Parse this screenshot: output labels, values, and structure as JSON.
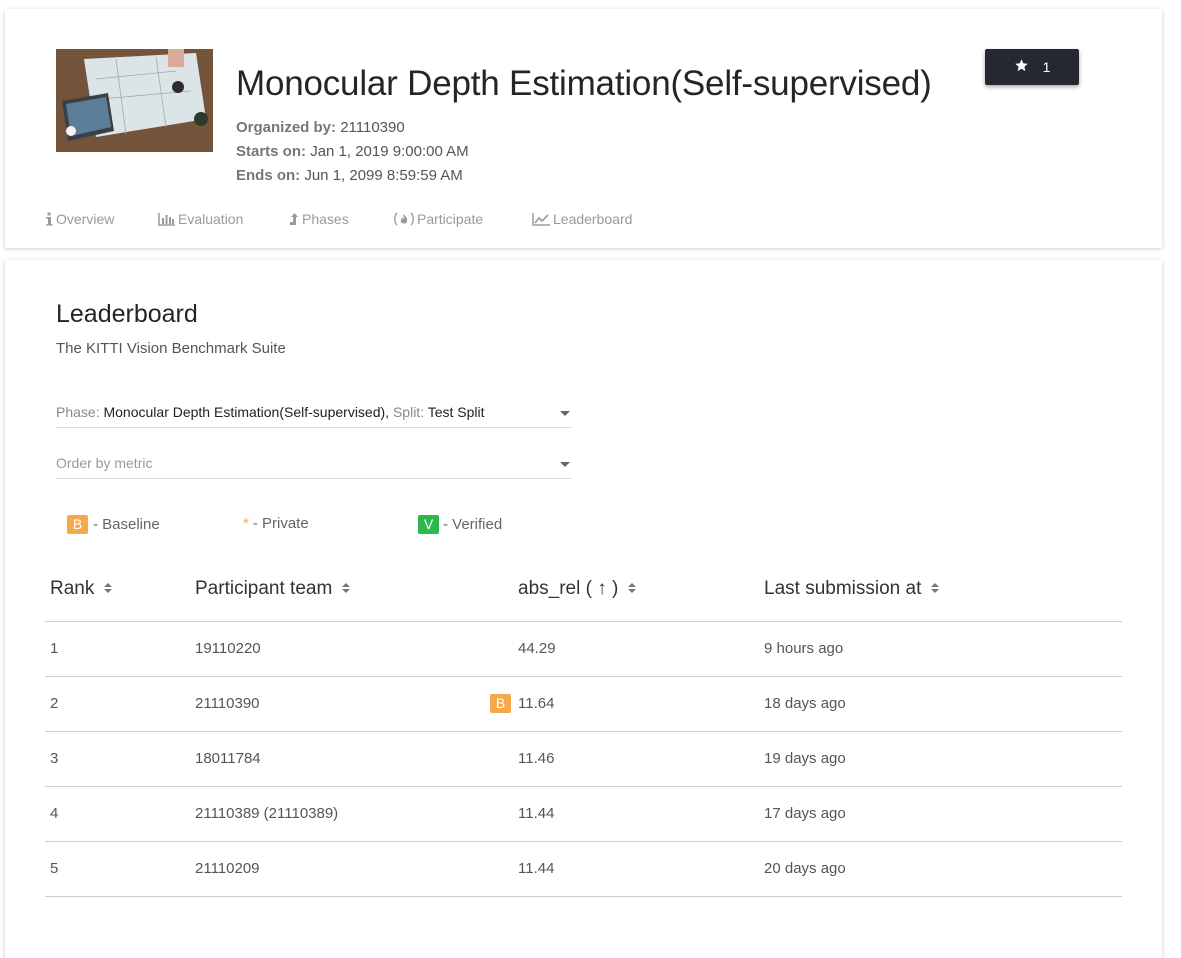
{
  "header": {
    "title": "Monocular Depth Estimation(Self-supervised)",
    "organized_label": "Organized by:",
    "organized_value": "21110390",
    "starts_label": "Starts on:",
    "starts_value": "Jan 1, 2019 9:00:00 AM",
    "ends_label": "Ends on:",
    "ends_value": "Jun 1, 2099 8:59:59 AM",
    "star_count": "1",
    "star_icon": "star-icon"
  },
  "tabs": [
    {
      "label": "Overview",
      "icon": "info-icon"
    },
    {
      "label": "Evaluation",
      "icon": "bar-chart-icon"
    },
    {
      "label": "Phases",
      "icon": "arrow-up-icon"
    },
    {
      "label": "Participate",
      "icon": "flame-icon"
    },
    {
      "label": "Leaderboard",
      "icon": "line-chart-icon"
    }
  ],
  "leaderboard": {
    "title": "Leaderboard",
    "subtitle": "The KITTI Vision Benchmark Suite",
    "phase_label": "Phase:",
    "phase_value": "Monocular Depth Estimation(Self-supervised),",
    "split_label": "Split:",
    "split_value": "Test Split",
    "order_placeholder": "Order by metric",
    "legend": {
      "baseline_badge": "B",
      "baseline_text": "- Baseline",
      "private_mark": "*",
      "private_text": "- Private",
      "verified_badge": "V",
      "verified_text": "- Verified"
    },
    "columns": [
      "Rank",
      "Participant team",
      "abs_rel ( ↑ )",
      "Last submission at"
    ],
    "rows": [
      {
        "rank": "1",
        "team": "19110220",
        "abs_rel": "44.29",
        "last": "9 hours ago",
        "badge": ""
      },
      {
        "rank": "2",
        "team": "21110390",
        "abs_rel": "11.64",
        "last": "18 days ago",
        "badge": "B"
      },
      {
        "rank": "3",
        "team": "18011784",
        "abs_rel": "11.46",
        "last": "19 days ago",
        "badge": ""
      },
      {
        "rank": "4",
        "team": "21110389 (21110389)",
        "abs_rel": "11.44",
        "last": "17 days ago",
        "badge": ""
      },
      {
        "rank": "5",
        "team": "21110209",
        "abs_rel": "11.44",
        "last": "20 days ago",
        "badge": ""
      }
    ]
  },
  "colors": {
    "baseline": "#f5a94b",
    "verified": "#2db84d",
    "star_button": "#252833"
  }
}
